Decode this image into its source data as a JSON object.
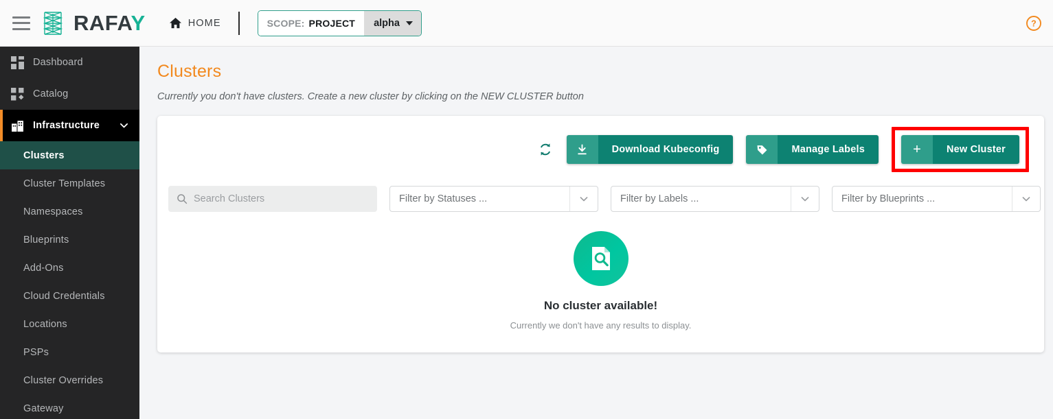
{
  "topbar": {
    "menu_icon": "hamburger-icon",
    "logo_text_dark": "RAFA",
    "logo_text_accent": "Y",
    "home_label": "HOME",
    "scope_key": "SCOPE:",
    "scope_value": "PROJECT",
    "project_name": "alpha",
    "help_icon": "help-circle-icon"
  },
  "sidebar": {
    "items": [
      {
        "label": "Dashboard",
        "icon": "grid-icon",
        "type": "item"
      },
      {
        "label": "Catalog",
        "icon": "catalog-icon",
        "type": "item"
      },
      {
        "label": "Infrastructure",
        "icon": "building-icon",
        "type": "group",
        "expanded": true
      },
      {
        "label": "Clusters",
        "type": "sub",
        "active": true
      },
      {
        "label": "Cluster Templates",
        "type": "sub"
      },
      {
        "label": "Namespaces",
        "type": "sub"
      },
      {
        "label": "Blueprints",
        "type": "sub"
      },
      {
        "label": "Add-Ons",
        "type": "sub"
      },
      {
        "label": "Cloud Credentials",
        "type": "sub"
      },
      {
        "label": "Locations",
        "type": "sub"
      },
      {
        "label": "PSPs",
        "type": "sub"
      },
      {
        "label": "Cluster Overrides",
        "type": "sub"
      },
      {
        "label": "Gateway",
        "type": "sub"
      }
    ]
  },
  "main": {
    "title": "Clusters",
    "subtitle": "Currently you don't have clusters. Create a new cluster by clicking on the NEW CLUSTER button",
    "toolbar": {
      "refresh_icon": "refresh-icon",
      "download_kubeconfig_label": "Download Kubeconfig",
      "download_icon": "download-icon",
      "manage_labels_label": "Manage Labels",
      "label_icon": "tag-icon",
      "new_cluster_label": "New Cluster",
      "new_cluster_icon": "plus-icon"
    },
    "filters": {
      "search_placeholder": "Search Clusters",
      "search_value": "",
      "search_icon": "search-icon",
      "status_filter": "Filter by Statuses ...",
      "labels_filter": "Filter by Labels ...",
      "blueprints_filter": "Filter by Blueprints ..."
    },
    "empty_state": {
      "icon": "document-search-icon",
      "title": "No cluster available!",
      "subtitle": "Currently we don't have any results to display."
    }
  },
  "colors": {
    "accent_orange": "#f2891e",
    "teal_dark": "#0d8272",
    "teal_light": "#2f9e8b",
    "sidebar_bg": "#252526",
    "active_sub_bg": "#1f5048",
    "highlight_red": "#ff0000"
  }
}
